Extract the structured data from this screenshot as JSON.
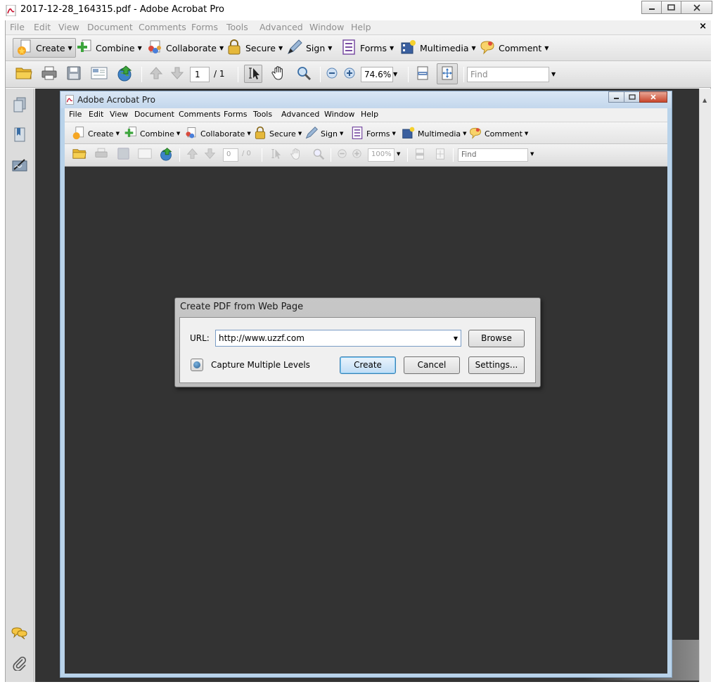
{
  "window": {
    "title": "2017-12-28_164315.pdf - Adobe Acrobat Pro"
  },
  "menu": [
    "File",
    "Edit",
    "View",
    "Document",
    "Comments",
    "Forms",
    "Tools",
    "Advanced",
    "Window",
    "Help"
  ],
  "menu_close": "×",
  "toolbar": {
    "create": "Create",
    "combine": "Combine",
    "collaborate": "Collaborate",
    "secure": "Secure",
    "sign": "Sign",
    "forms": "Forms",
    "multimedia": "Multimedia",
    "comment": "Comment"
  },
  "nav": {
    "page": "1",
    "total": "/ 1",
    "zoom": "74.6%",
    "find_placeholder": "Find"
  },
  "inner": {
    "title": "Adobe Acrobat Pro",
    "menu": [
      "File",
      "Edit",
      "View",
      "Document",
      "Comments",
      "Forms",
      "Tools",
      "Advanced",
      "Window",
      "Help"
    ],
    "toolbar": {
      "create": "Create",
      "combine": "Combine",
      "collaborate": "Collaborate",
      "secure": "Secure",
      "sign": "Sign",
      "forms": "Forms",
      "multimedia": "Multimedia",
      "comment": "Comment"
    },
    "nav": {
      "page": "0",
      "total": "/ 0",
      "zoom": "100%",
      "find_placeholder": "Find"
    }
  },
  "dialog": {
    "title": "Create PDF from Web Page",
    "url_label": "URL:",
    "url_value": "http://www.uzzf.com",
    "browse": "Browse",
    "capture_label": "Capture Multiple Levels",
    "create": "Create",
    "cancel": "Cancel",
    "settings": "Settings..."
  },
  "icons": {
    "pdf": "adobe-pdf-icon",
    "create": "create-pdf-icon",
    "combine": "combine-files-icon",
    "collaborate": "collaborate-icon",
    "secure": "padlock-icon",
    "sign": "pen-icon",
    "forms": "forms-icon",
    "multimedia": "multimedia-icon",
    "comment": "comment-bubble-icon"
  }
}
